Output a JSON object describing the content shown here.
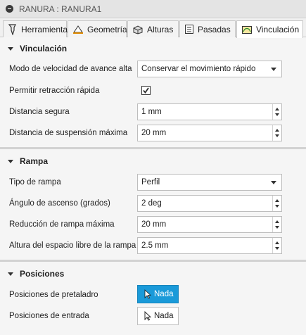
{
  "window": {
    "title": "RANURA : RANURA1"
  },
  "tabs": [
    {
      "label": "Herramienta",
      "icon": "tool-icon"
    },
    {
      "label": "Geometría",
      "icon": "geometry-icon"
    },
    {
      "label": "Alturas",
      "icon": "heights-icon"
    },
    {
      "label": "Pasadas",
      "icon": "passes-icon"
    },
    {
      "label": "Vinculación",
      "icon": "linking-icon",
      "active": true
    }
  ],
  "vinculacion": {
    "header": "Vinculación",
    "feed_mode": {
      "label": "Modo de velocidad de avance alta",
      "value": "Conservar el movimiento rápido"
    },
    "fast_retract": {
      "label": "Permitir retracción rápida",
      "checked": true
    },
    "safe_distance": {
      "label": "Distancia segura",
      "value": "1 mm"
    },
    "max_stay_down": {
      "label": "Distancia de suspensión máxima",
      "value": "20 mm"
    }
  },
  "rampa": {
    "header": "Rampa",
    "ramp_type": {
      "label": "Tipo de rampa",
      "value": "Perfil"
    },
    "ramp_angle": {
      "label": "Ángulo de ascenso (grados)",
      "value": "2 deg"
    },
    "max_stepdown": {
      "label": "Reducción de rampa máxima",
      "value": "20 mm"
    },
    "clearance_height": {
      "label": "Altura del espacio libre de la rampa",
      "value": "2.5 mm"
    }
  },
  "posiciones": {
    "header": "Posiciones",
    "predrill": {
      "label": "Posiciones de pretaladro",
      "button": "Nada",
      "selected": true
    },
    "entry": {
      "label": "Posiciones de entrada",
      "button": "Nada",
      "selected": false
    }
  },
  "colors": {
    "accent": "#1a9ad9"
  }
}
